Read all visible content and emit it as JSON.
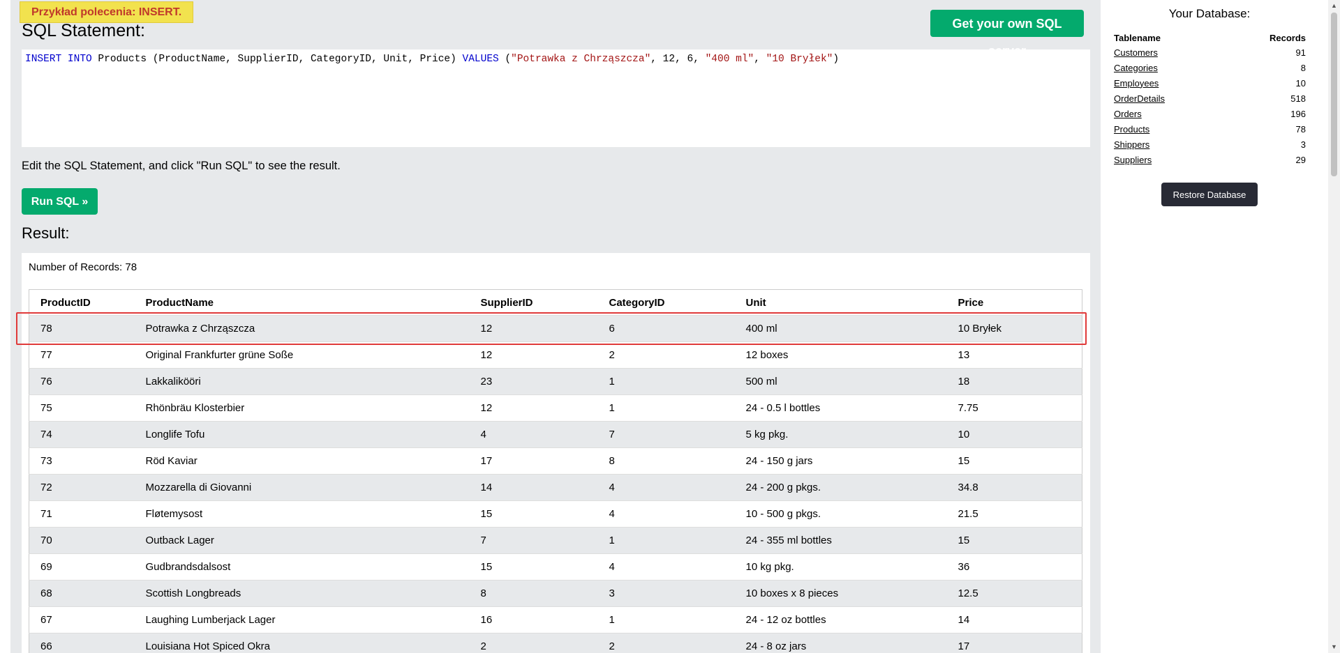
{
  "tooltip": "Przykład polecenia: INSERT.",
  "sql_title": "SQL Statement:",
  "get_server_label": "Get your own SQL server",
  "sql": {
    "p1": "INSERT INTO",
    "p2": " Products (ProductName, SupplierID, CategoryID, Unit, Price) ",
    "p3": "VALUES",
    "p4": " (",
    "p5": "\"Potrawka z Chrząszcza\"",
    "p6": ", 12, 6, ",
    "p7": "\"400 ml\"",
    "p8": ", ",
    "p9": "\"10 Bryłek\"",
    "p10": ")"
  },
  "hint": "Edit the SQL Statement, and click \"Run SQL\" to see the result.",
  "run_label": "Run SQL »",
  "result_title": "Result:",
  "record_count": "Number of Records: 78",
  "columns": [
    "ProductID",
    "ProductName",
    "SupplierID",
    "CategoryID",
    "Unit",
    "Price"
  ],
  "rows": [
    [
      "78",
      "Potrawka z Chrząszcza",
      "12",
      "6",
      "400 ml",
      "10 Bryłek"
    ],
    [
      "77",
      "Original Frankfurter grüne Soße",
      "12",
      "2",
      "12 boxes",
      "13"
    ],
    [
      "76",
      "Lakkalikööri",
      "23",
      "1",
      "500 ml",
      "18"
    ],
    [
      "75",
      "Rhönbräu Klosterbier",
      "12",
      "1",
      "24 - 0.5 l bottles",
      "7.75"
    ],
    [
      "74",
      "Longlife Tofu",
      "4",
      "7",
      "5 kg pkg.",
      "10"
    ],
    [
      "73",
      "Röd Kaviar",
      "17",
      "8",
      "24 - 150 g jars",
      "15"
    ],
    [
      "72",
      "Mozzarella di Giovanni",
      "14",
      "4",
      "24 - 200 g pkgs.",
      "34.8"
    ],
    [
      "71",
      "Fløtemysost",
      "15",
      "4",
      "10 - 500 g pkgs.",
      "21.5"
    ],
    [
      "70",
      "Outback Lager",
      "7",
      "1",
      "24 - 355 ml bottles",
      "15"
    ],
    [
      "69",
      "Gudbrandsdalsost",
      "15",
      "4",
      "10 kg pkg.",
      "36"
    ],
    [
      "68",
      "Scottish Longbreads",
      "8",
      "3",
      "10 boxes x 8 pieces",
      "12.5"
    ],
    [
      "67",
      "Laughing Lumberjack Lager",
      "16",
      "1",
      "24 - 12 oz bottles",
      "14"
    ],
    [
      "66",
      "Louisiana Hot Spiced Okra",
      "2",
      "2",
      "24 - 8 oz jars",
      "17"
    ]
  ],
  "sidebar": {
    "title": "Your Database:",
    "col_table": "Tablename",
    "col_records": "Records",
    "tables": [
      {
        "name": "Customers",
        "records": "91"
      },
      {
        "name": "Categories",
        "records": "8"
      },
      {
        "name": "Employees",
        "records": "10"
      },
      {
        "name": "OrderDetails",
        "records": "518"
      },
      {
        "name": "Orders",
        "records": "196"
      },
      {
        "name": "Products",
        "records": "78"
      },
      {
        "name": "Shippers",
        "records": "3"
      },
      {
        "name": "Suppliers",
        "records": "29"
      }
    ],
    "restore_label": "Restore Database"
  },
  "colors": {
    "accent": "#04aa6d",
    "panel_bg": "#e7e9eb",
    "tooltip_bg": "#f2e24e",
    "tooltip_text": "#c0392b",
    "highlight": "#e03a3a",
    "dark_button": "#282a35"
  },
  "icons": {
    "scroll_up": "▲",
    "scroll_down": "▼"
  }
}
